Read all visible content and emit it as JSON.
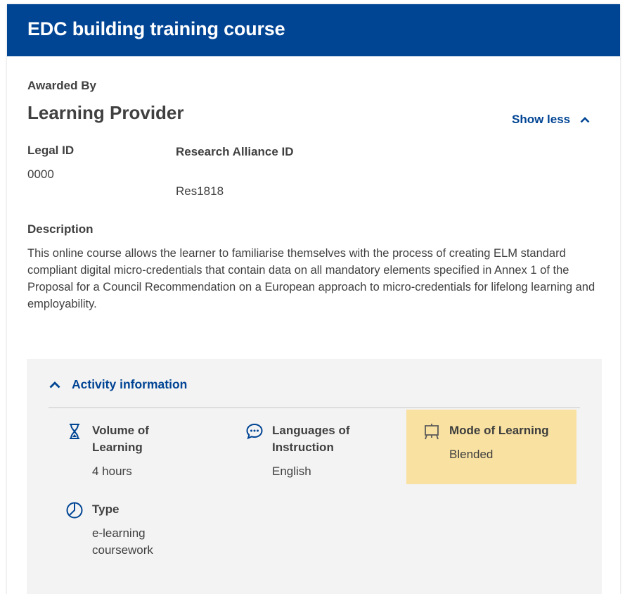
{
  "header": {
    "title": "EDC building training course"
  },
  "awarded": {
    "label": "Awarded By",
    "provider": "Learning Provider",
    "toggle_label": "Show less"
  },
  "identifiers": {
    "legal_id_label": "Legal ID",
    "legal_id_value": "0000",
    "research_alliance_label": "Research Alliance ID",
    "research_alliance_value": "Res1818"
  },
  "description": {
    "label": "Description",
    "text": "This online course allows the learner to familiarise themselves with the process of creating ELM standard compliant digital micro-credentials that contain data on all mandatory elements specified in Annex 1 of the Proposal for a Council Recommendation on a European approach to micro-credentials for lifelong learning and employability."
  },
  "activity": {
    "title": "Activity information",
    "items": [
      {
        "label": "Volume of Learning",
        "value": "4 hours",
        "icon": "hourglass-icon"
      },
      {
        "label": "Languages of Instruction",
        "value": "English",
        "icon": "chat-bubble-icon"
      },
      {
        "label": "Mode of Learning",
        "value": "Blended",
        "icon": "presentation-board-icon",
        "highlight_color": "#f8e1a1"
      },
      {
        "label": "Type",
        "value": "e-learning coursework",
        "icon": "pie-chart-icon"
      }
    ]
  },
  "colors": {
    "brand": "#004494",
    "text": "#404040",
    "panel": "#f3f3f3"
  }
}
